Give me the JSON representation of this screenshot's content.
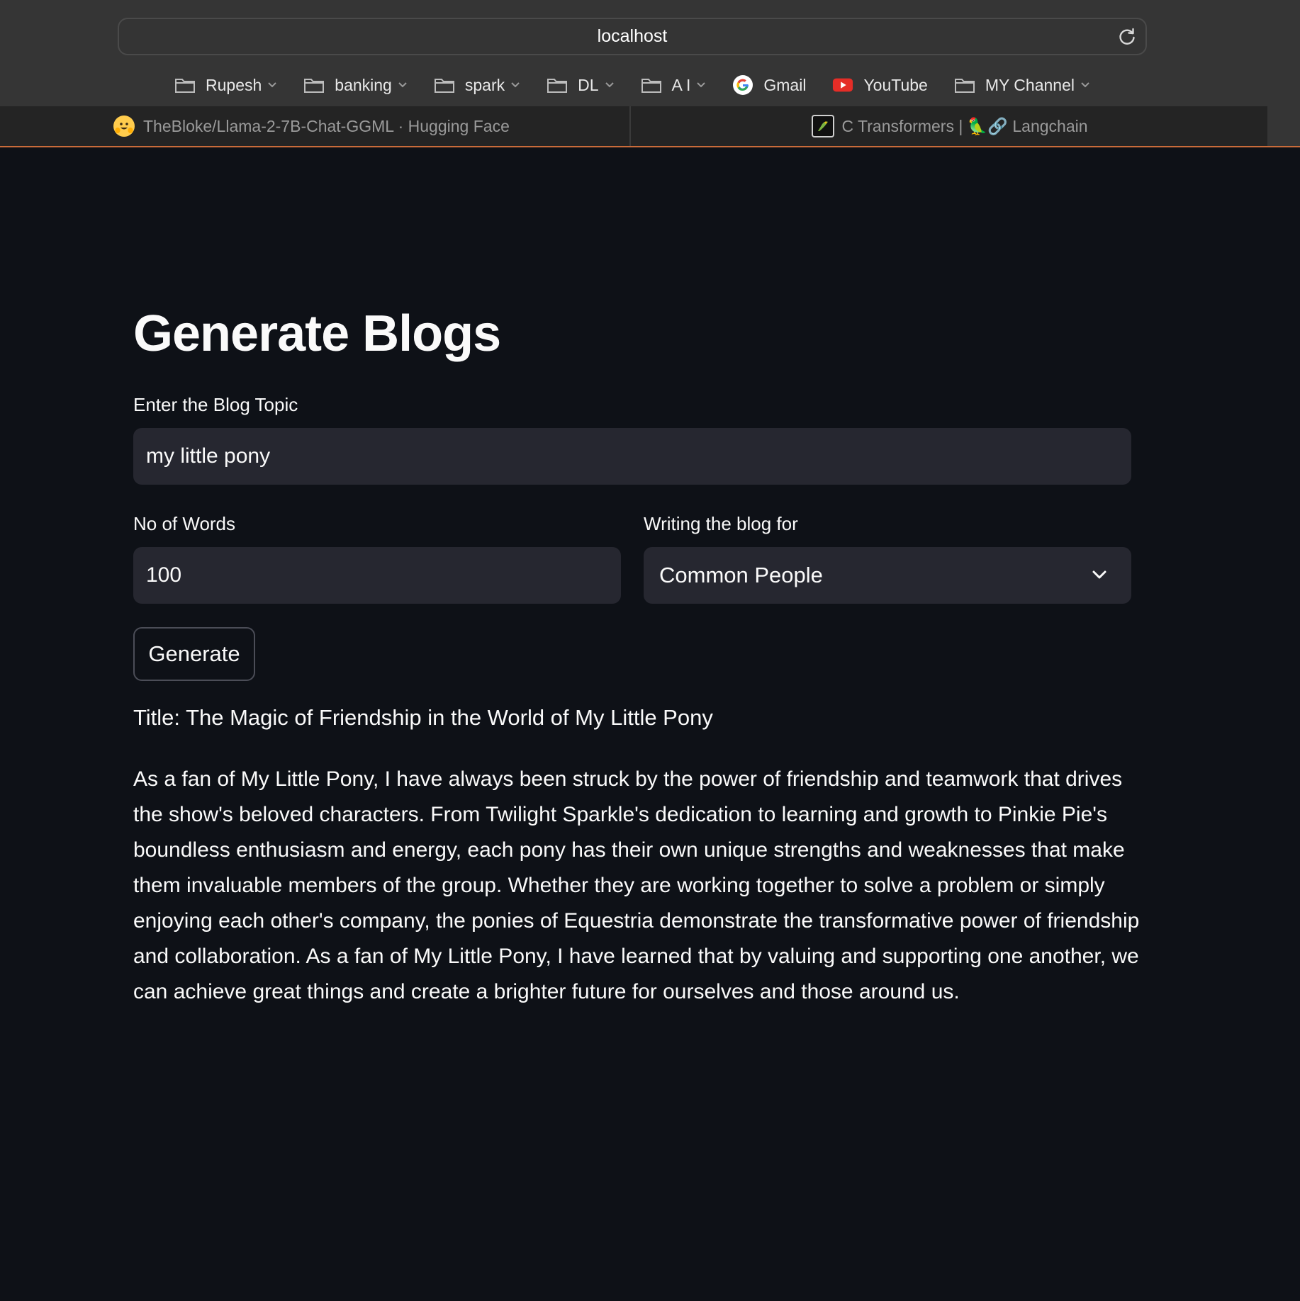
{
  "browser": {
    "url": "localhost",
    "bookmarks": [
      {
        "label": "Rupesh",
        "icon": "folder-icon",
        "dropdown": true
      },
      {
        "label": "banking",
        "icon": "folder-icon",
        "dropdown": true
      },
      {
        "label": "spark",
        "icon": "folder-icon",
        "dropdown": true
      },
      {
        "label": "DL",
        "icon": "folder-icon",
        "dropdown": true
      },
      {
        "label": "A I",
        "icon": "folder-icon",
        "dropdown": true
      },
      {
        "label": "Gmail",
        "icon": "google-icon",
        "dropdown": false
      },
      {
        "label": "YouTube",
        "icon": "youtube-icon",
        "dropdown": false
      },
      {
        "label": "MY Channel",
        "icon": "folder-icon",
        "dropdown": true
      }
    ],
    "tabs": [
      {
        "title": "TheBloke/Llama-2-7B-Chat-GGML · Hugging Face",
        "icon": "hugging-face-icon"
      },
      {
        "title": "C Transformers | 🦜🔗 Langchain",
        "icon": "langchain-icon"
      }
    ]
  },
  "app": {
    "title": "Generate Blogs",
    "topic_label": "Enter the Blog Topic",
    "topic_value": "my little pony",
    "words_label": "No of Words",
    "words_value": "100",
    "audience_label": "Writing the blog for",
    "audience_value": "Common People",
    "generate_label": "Generate",
    "output_title": "Title: The Magic of Friendship in the World of My Little Pony",
    "output_body": "As a fan of My Little Pony, I have always been struck by the power of friendship and teamwork that drives the show's beloved characters. From Twilight Sparkle's dedication to learning and growth to Pinkie Pie's boundless enthusiasm and energy, each pony has their own unique strengths and weaknesses that make them invaluable members of the group. Whether they are working together to solve a problem or simply enjoying each other's company, the ponies of Equestria demonstrate the transformative power of friendship and collaboration. As a fan of My Little Pony, I have learned that by valuing and supporting one another, we can achieve great things and create a brighter future for ourselves and those around us."
  },
  "colors": {
    "background": "#0e1117",
    "input_bg": "#262730",
    "chrome_bg": "#353535",
    "tab_accent": "#c96b3a"
  }
}
